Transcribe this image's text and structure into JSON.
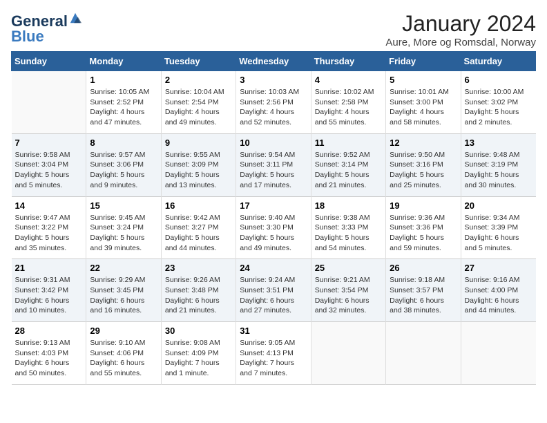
{
  "header": {
    "logo_line1": "General",
    "logo_line2": "Blue",
    "month": "January 2024",
    "location": "Aure, More og Romsdal, Norway"
  },
  "days_of_week": [
    "Sunday",
    "Monday",
    "Tuesday",
    "Wednesday",
    "Thursday",
    "Friday",
    "Saturday"
  ],
  "weeks": [
    [
      {
        "num": "",
        "info": ""
      },
      {
        "num": "1",
        "info": "Sunrise: 10:05 AM\nSunset: 2:52 PM\nDaylight: 4 hours\nand 47 minutes."
      },
      {
        "num": "2",
        "info": "Sunrise: 10:04 AM\nSunset: 2:54 PM\nDaylight: 4 hours\nand 49 minutes."
      },
      {
        "num": "3",
        "info": "Sunrise: 10:03 AM\nSunset: 2:56 PM\nDaylight: 4 hours\nand 52 minutes."
      },
      {
        "num": "4",
        "info": "Sunrise: 10:02 AM\nSunset: 2:58 PM\nDaylight: 4 hours\nand 55 minutes."
      },
      {
        "num": "5",
        "info": "Sunrise: 10:01 AM\nSunset: 3:00 PM\nDaylight: 4 hours\nand 58 minutes."
      },
      {
        "num": "6",
        "info": "Sunrise: 10:00 AM\nSunset: 3:02 PM\nDaylight: 5 hours\nand 2 minutes."
      }
    ],
    [
      {
        "num": "7",
        "info": "Sunrise: 9:58 AM\nSunset: 3:04 PM\nDaylight: 5 hours\nand 5 minutes."
      },
      {
        "num": "8",
        "info": "Sunrise: 9:57 AM\nSunset: 3:06 PM\nDaylight: 5 hours\nand 9 minutes."
      },
      {
        "num": "9",
        "info": "Sunrise: 9:55 AM\nSunset: 3:09 PM\nDaylight: 5 hours\nand 13 minutes."
      },
      {
        "num": "10",
        "info": "Sunrise: 9:54 AM\nSunset: 3:11 PM\nDaylight: 5 hours\nand 17 minutes."
      },
      {
        "num": "11",
        "info": "Sunrise: 9:52 AM\nSunset: 3:14 PM\nDaylight: 5 hours\nand 21 minutes."
      },
      {
        "num": "12",
        "info": "Sunrise: 9:50 AM\nSunset: 3:16 PM\nDaylight: 5 hours\nand 25 minutes."
      },
      {
        "num": "13",
        "info": "Sunrise: 9:48 AM\nSunset: 3:19 PM\nDaylight: 5 hours\nand 30 minutes."
      }
    ],
    [
      {
        "num": "14",
        "info": "Sunrise: 9:47 AM\nSunset: 3:22 PM\nDaylight: 5 hours\nand 35 minutes."
      },
      {
        "num": "15",
        "info": "Sunrise: 9:45 AM\nSunset: 3:24 PM\nDaylight: 5 hours\nand 39 minutes."
      },
      {
        "num": "16",
        "info": "Sunrise: 9:42 AM\nSunset: 3:27 PM\nDaylight: 5 hours\nand 44 minutes."
      },
      {
        "num": "17",
        "info": "Sunrise: 9:40 AM\nSunset: 3:30 PM\nDaylight: 5 hours\nand 49 minutes."
      },
      {
        "num": "18",
        "info": "Sunrise: 9:38 AM\nSunset: 3:33 PM\nDaylight: 5 hours\nand 54 minutes."
      },
      {
        "num": "19",
        "info": "Sunrise: 9:36 AM\nSunset: 3:36 PM\nDaylight: 5 hours\nand 59 minutes."
      },
      {
        "num": "20",
        "info": "Sunrise: 9:34 AM\nSunset: 3:39 PM\nDaylight: 6 hours\nand 5 minutes."
      }
    ],
    [
      {
        "num": "21",
        "info": "Sunrise: 9:31 AM\nSunset: 3:42 PM\nDaylight: 6 hours\nand 10 minutes."
      },
      {
        "num": "22",
        "info": "Sunrise: 9:29 AM\nSunset: 3:45 PM\nDaylight: 6 hours\nand 16 minutes."
      },
      {
        "num": "23",
        "info": "Sunrise: 9:26 AM\nSunset: 3:48 PM\nDaylight: 6 hours\nand 21 minutes."
      },
      {
        "num": "24",
        "info": "Sunrise: 9:24 AM\nSunset: 3:51 PM\nDaylight: 6 hours\nand 27 minutes."
      },
      {
        "num": "25",
        "info": "Sunrise: 9:21 AM\nSunset: 3:54 PM\nDaylight: 6 hours\nand 32 minutes."
      },
      {
        "num": "26",
        "info": "Sunrise: 9:18 AM\nSunset: 3:57 PM\nDaylight: 6 hours\nand 38 minutes."
      },
      {
        "num": "27",
        "info": "Sunrise: 9:16 AM\nSunset: 4:00 PM\nDaylight: 6 hours\nand 44 minutes."
      }
    ],
    [
      {
        "num": "28",
        "info": "Sunrise: 9:13 AM\nSunset: 4:03 PM\nDaylight: 6 hours\nand 50 minutes."
      },
      {
        "num": "29",
        "info": "Sunrise: 9:10 AM\nSunset: 4:06 PM\nDaylight: 6 hours\nand 55 minutes."
      },
      {
        "num": "30",
        "info": "Sunrise: 9:08 AM\nSunset: 4:09 PM\nDaylight: 7 hours\nand 1 minute."
      },
      {
        "num": "31",
        "info": "Sunrise: 9:05 AM\nSunset: 4:13 PM\nDaylight: 7 hours\nand 7 minutes."
      },
      {
        "num": "",
        "info": ""
      },
      {
        "num": "",
        "info": ""
      },
      {
        "num": "",
        "info": ""
      }
    ]
  ]
}
